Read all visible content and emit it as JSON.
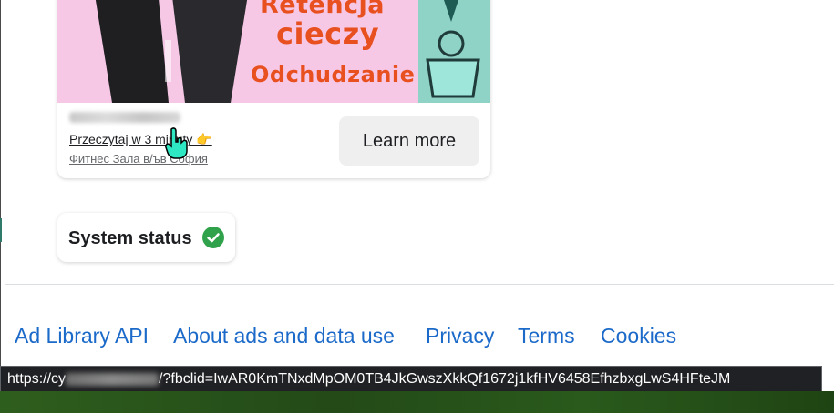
{
  "ad": {
    "image_text_line1": "Retencja",
    "image_text_line2": "cieczy",
    "image_text_line3": "Odchudzanie",
    "headline": "Przeczytaj w 3 minuty 👉",
    "subline": "Фитнес Зала в/ъв София",
    "cta_label": "Learn more"
  },
  "system_status": {
    "label": "System status"
  },
  "footer": {
    "links": [
      {
        "label": "Ad Library API"
      },
      {
        "label": "About ads and data use"
      },
      {
        "label": "Privacy"
      },
      {
        "label": "Terms"
      },
      {
        "label": "Cookies"
      }
    ]
  },
  "status_bar": {
    "url_prefix": "https://cy",
    "url_suffix": "/?fbclid=IwAR0KmTNxdMpOM0TB4JkGwszXkkQf1672j1kfHV6458EfhzbxgLwS4HFteJM"
  },
  "colors": {
    "link": "#1b6ac9",
    "status_ok": "#31a24c",
    "ad_accent": "#e8501f"
  }
}
